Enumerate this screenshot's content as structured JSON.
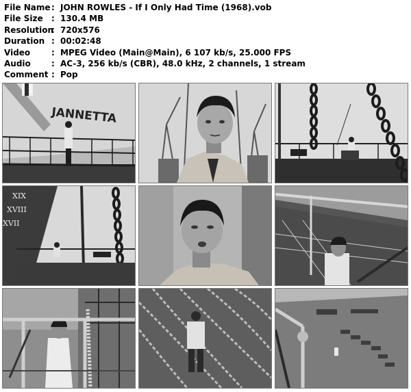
{
  "info": [
    {
      "key": "File Name",
      "sep": ":",
      "value": "JOHN ROWLES - If I Only Had Time (1968).vob"
    },
    {
      "key": "File Size",
      "sep": ":",
      "value": "130.4 MB"
    },
    {
      "key": "Resolution",
      "sep": ":",
      "value": "720x576"
    },
    {
      "key": "Duration",
      "sep": ":",
      "value": "00:02:48"
    },
    {
      "key": "Video",
      "sep": ":",
      "value": "MPEG Video (Main@Main), 6 107 kb/s, 25.000 FPS"
    },
    {
      "key": "Audio",
      "sep": ":",
      "value": "AC-3, 256 kb/s (CBR), 48.0 kHz, 2 channels, 1 stream"
    },
    {
      "key": "Comment",
      "sep": ":",
      "value": "Pop"
    }
  ],
  "frames": {
    "ship_hull_text": "JANNETTA",
    "hull_markings": [
      "XIX",
      "XVIII",
      "XVII"
    ]
  },
  "colors": {
    "background": "#ffffff",
    "text": "#000000",
    "frame_border": "#777777"
  }
}
